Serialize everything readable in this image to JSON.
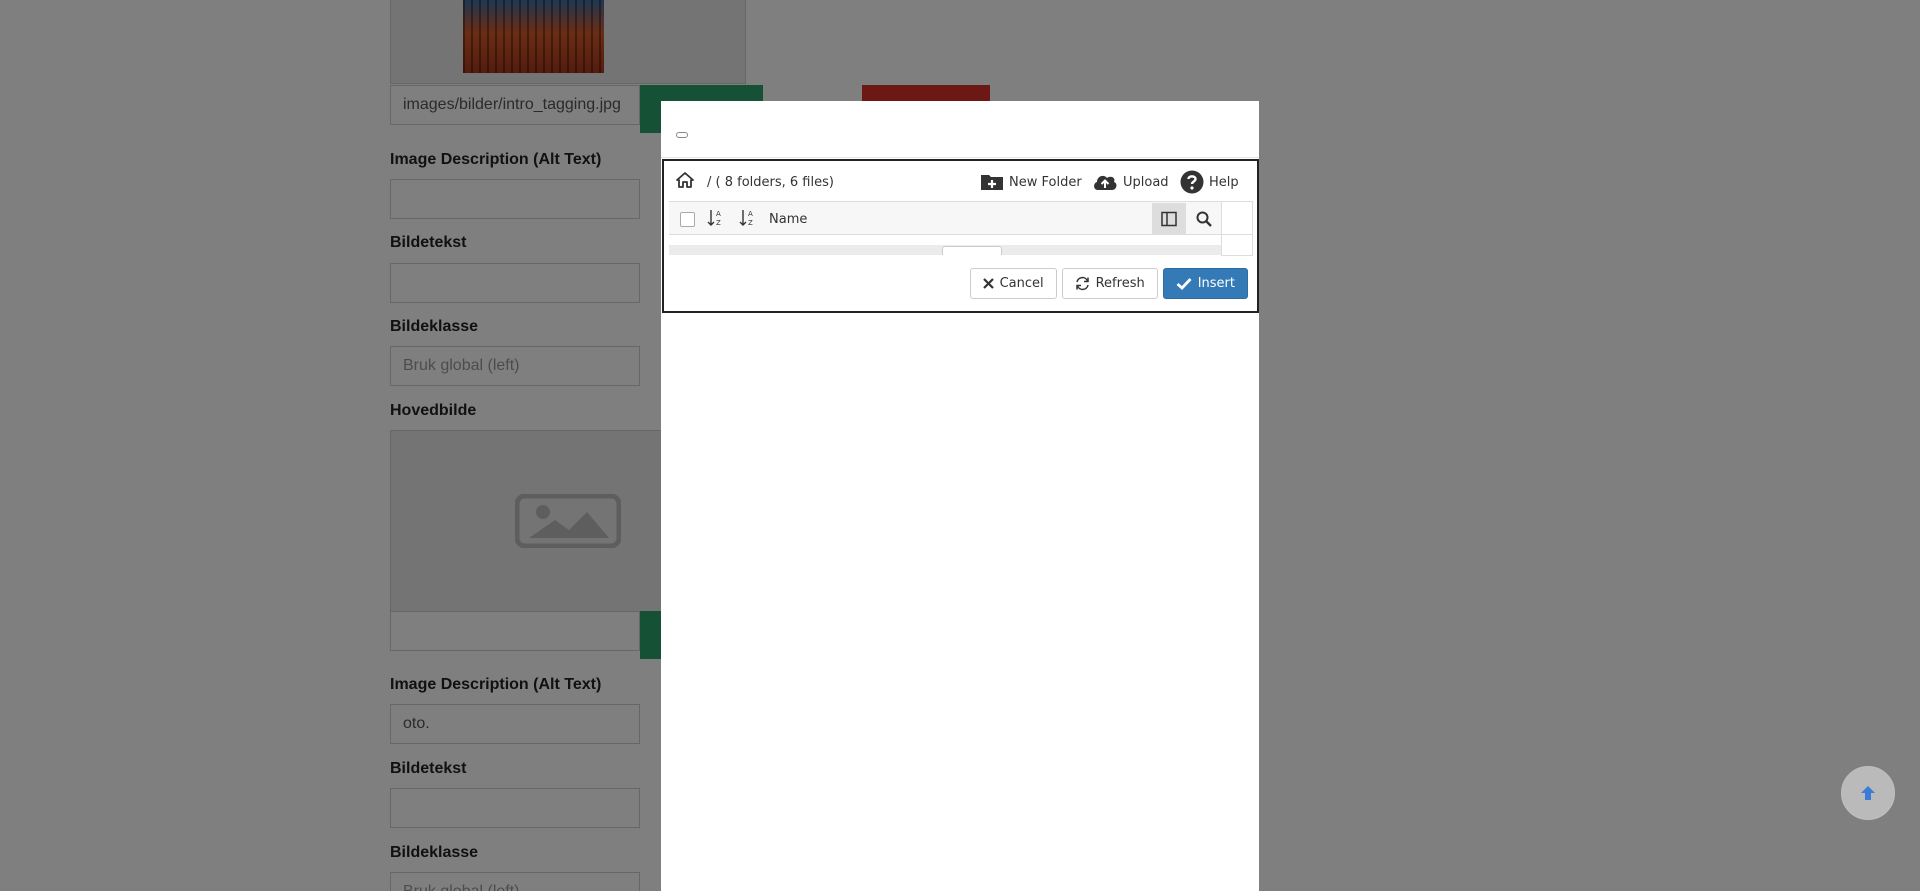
{
  "background_form": {
    "top_image_path": "images/bilder/intro_tagging.jpg",
    "section1": {
      "alt_label": "Image Description (Alt Text)",
      "alt_value": "",
      "caption_label": "Bildetekst",
      "caption_value": "",
      "class_label": "Bildeklasse",
      "class_placeholder": "Bruk global (left)"
    },
    "main_image_label": "Hovedbilde",
    "main_image_path": "",
    "section2": {
      "alt_label": "Image Description (Alt Text)",
      "alt_value": "oto.",
      "caption_label": "Bildetekst",
      "caption_value": "",
      "class_label": "Bildeklasse",
      "class_placeholder": "Bruk global (left)"
    }
  },
  "modal": {
    "breadcrumb": "/ ( 8 folders, 6 files)",
    "toolbar": {
      "new_folder": "New Folder",
      "upload": "Upload",
      "help": "Help"
    },
    "grid": {
      "name_header": "Name"
    },
    "actions": {
      "cancel": "Cancel",
      "refresh": "Refresh",
      "insert": "Insert"
    }
  },
  "icons": {
    "home": "home-icon",
    "new_folder": "folder-plus-icon",
    "upload": "cloud-upload-icon",
    "help": "question-circle-icon",
    "sort_asc": "sort-alpha-asc-icon",
    "sort_desc": "sort-alpha-desc-icon",
    "columns": "columns-icon",
    "search": "search-icon",
    "cancel": "close-icon",
    "refresh": "refresh-icon",
    "insert": "check-icon",
    "scroll_top": "arrow-up-icon",
    "image_placeholder": "image-placeholder-icon"
  },
  "colors": {
    "primary": "#337ab7",
    "green": "#2aa26a",
    "red": "#d9332a",
    "overlay": "rgba(0,0,0,0.5)"
  }
}
